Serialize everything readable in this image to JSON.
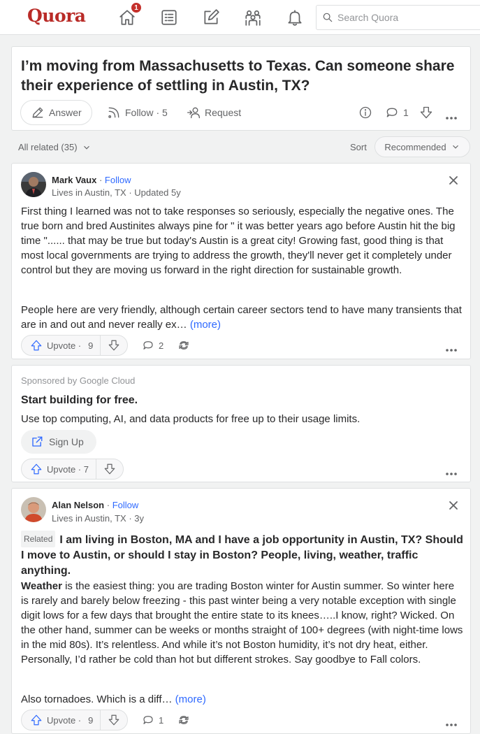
{
  "brand": {
    "logo": "Quora",
    "accent": "#b92b27",
    "link_color": "#2e69ff"
  },
  "nav": {
    "icons": [
      "home-icon",
      "answer-list-icon",
      "edit-icon",
      "spaces-icon",
      "bell-icon"
    ],
    "home_badge": "1",
    "search_placeholder": "Search Quora"
  },
  "question": {
    "title": "I’m moving from Massachusetts to Texas. Can someone share their experience of settling in Austin, TX?",
    "answer_label": "Answer",
    "follow_label": "Follow",
    "follow_count": "· 5",
    "request_label": "Request",
    "comment_count": "1"
  },
  "related_bar": {
    "label": "All related (35)",
    "sort_label": "Sort",
    "sort_value": "Recommended"
  },
  "answer1": {
    "author": "Mark Vaux",
    "follow": "Follow",
    "meta": "Lives in Austin, TX · Updated 5y",
    "para1": "First thing I learned was not to take responses so seriously, especially the negative ones. The true born and bred Austinites always pine for \" it was better years ago before Austin hit the big time \"...... that may be true but today's Austin is a great city! Growing fast, good thing is that most local governments are trying to address the growth, they'll never get it completely under control but they are moving us forward in the right direction for sustainable growth.",
    "para2": "People here are very friendly, although certain career sectors tend to have many transients that are in and out and never really ex…",
    "more": "(more)",
    "upvote_label": "Upvote ·",
    "upvote_count": "9",
    "comments": "2"
  },
  "ad": {
    "sponsor": "Sponsored by Google Cloud",
    "title": "Start building for free.",
    "text": "Use top computing, AI, and data products for free up to their usage limits.",
    "cta": "Sign Up",
    "upvote_label": "Upvote · 7"
  },
  "answer2": {
    "author": "Alan Nelson",
    "follow": "Follow",
    "meta": "Lives in Austin, TX · 3y",
    "related_tag": "Related",
    "related_question": "I am living in Boston, MA and I have a job opportunity in Austin, TX? Should I move to Austin, or should I stay in Boston? People, living, weather, traffic anything.",
    "lead_bold": "Weather",
    "para1": " is the easiest thing: you are trading Boston winter for Austin summer. So winter here is rarely and barely below freezing - this past winter being a very notable exception with single digit lows for a few days that brought the entire state to its knees…..I know, right? Wicked. On the other hand, summer can be weeks or months straight of 100+ degrees (with night-time lows in the mid 80s). It’s relentless. And while it’s not Boston humidity, it’s not dry heat, either. Personally, I’d rather be cold than hot but different strokes. Say goodbye to Fall colors.",
    "para2": "Also tornadoes. Which is a diff…",
    "more": "(more)",
    "upvote_label": "Upvote ·",
    "upvote_count": "9",
    "comments": "1"
  }
}
